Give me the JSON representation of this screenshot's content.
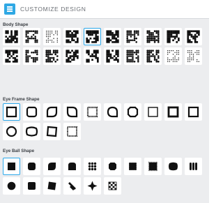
{
  "header": {
    "title": "CUSTOMIZE DESIGN",
    "icon": "grid-menu-icon",
    "accent_color": "#2ba8ea"
  },
  "sections": {
    "body_shape": {
      "title": "Body Shape",
      "selected_index": 4,
      "items": [
        "body-square",
        "body-vertical-bars",
        "body-dots",
        "body-round-modules",
        "body-small-squares",
        "body-rounded-corners",
        "body-circles",
        "body-blocks",
        "body-leaf",
        "body-cross",
        "body-pointed",
        "body-diamond",
        "body-horizontal-bars",
        "body-connected",
        "body-stars",
        "body-frame-blocks",
        "body-soft-edges",
        "body-splash",
        "body-dotted-fine",
        "body-dotted-cluster"
      ]
    },
    "eye_frame_shape": {
      "title": "Eye Frame Shape",
      "selected_index": 0,
      "items": [
        "frame-square",
        "frame-rounded",
        "frame-leaf",
        "frame-leaf-alt",
        "frame-dotted",
        "frame-drop",
        "frame-octagon",
        "frame-thin-square",
        "frame-bold-square",
        "frame-circle-square",
        "frame-circle",
        "frame-cushion",
        "frame-skewed",
        "frame-dotted-small"
      ]
    },
    "eye_ball_shape": {
      "title": "Eye Ball Shape",
      "selected_index": 0,
      "items": [
        "ball-square",
        "ball-rounded",
        "ball-leaf",
        "ball-rounded-top",
        "ball-dots-grid",
        "ball-octagon",
        "ball-dotted-square",
        "ball-stitched",
        "ball-cushion",
        "ball-bars",
        "ball-circle",
        "ball-soft-square",
        "ball-skewed",
        "ball-diagonal",
        "ball-star",
        "ball-checker"
      ]
    }
  }
}
